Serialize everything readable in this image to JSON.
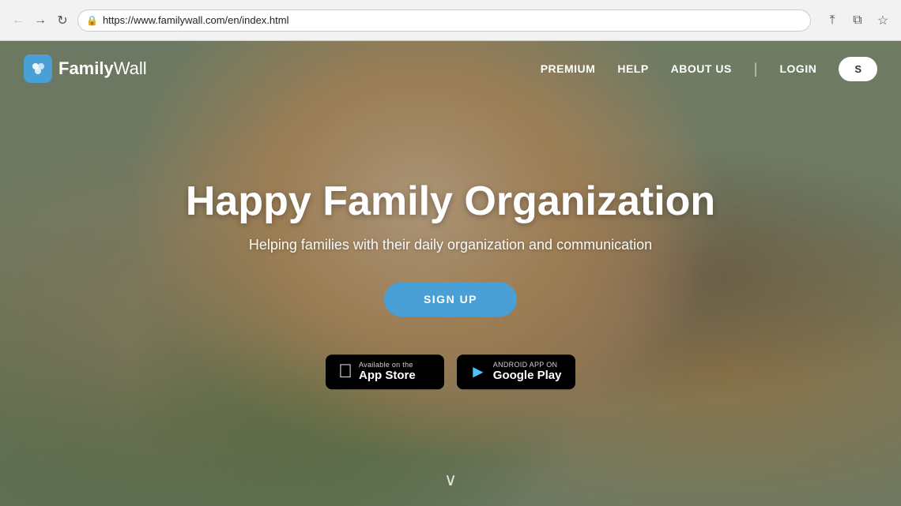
{
  "browser": {
    "url": "https://www.familywall.com/en/index.html",
    "back_btn": "←",
    "forward_btn": "→",
    "reload_btn": "↻",
    "lock_icon": "🔒"
  },
  "navbar": {
    "logo_text_regular": "Family",
    "logo_text_bold": "Wall",
    "nav_items": [
      {
        "label": "PREMIUM",
        "id": "premium"
      },
      {
        "label": "HELP",
        "id": "help"
      },
      {
        "label": "ABOUT US",
        "id": "about-us"
      }
    ],
    "login_label": "LOGIN",
    "signup_label": "S"
  },
  "hero": {
    "title": "Happy Family Organization",
    "subtitle": "Helping families with their daily organization and communication",
    "signup_btn": "SIGN UP",
    "app_store": {
      "small_text": "Available on the",
      "name": "App Store"
    },
    "google_play": {
      "small_text": "ANDROID APP ON",
      "name": "Google Play"
    }
  },
  "scroll": {
    "icon": "∨"
  }
}
